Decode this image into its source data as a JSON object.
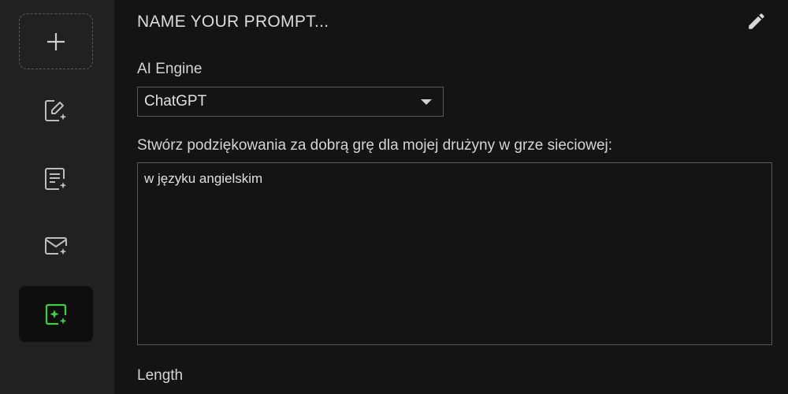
{
  "sidebar": {
    "items": [
      {
        "name": "add-prompt",
        "icon": "plus-icon"
      },
      {
        "name": "edit-sparkle",
        "icon": "pencil-sparkle-icon"
      },
      {
        "name": "document-sparkle",
        "icon": "document-sparkle-icon"
      },
      {
        "name": "mail-sparkle",
        "icon": "mail-sparkle-icon"
      },
      {
        "name": "image-sparkle",
        "icon": "image-sparkle-icon",
        "active": true
      }
    ],
    "active_color": "#3fcf3f"
  },
  "main": {
    "title_placeholder": "NAME YOUR PROMPT...",
    "engine_label": "AI Engine",
    "engine_value": "ChatGPT",
    "instruction_label": "Stwórz podziękowania za dobrą grę dla mojej drużyny w grze sieciowej:",
    "instruction_value": "w języku angielskim",
    "length_label": "Length"
  }
}
